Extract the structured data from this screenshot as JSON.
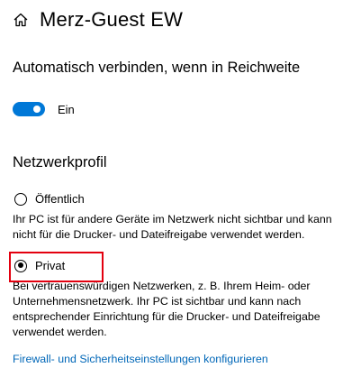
{
  "header": {
    "title": "Merz-Guest EW",
    "icon": "home-icon"
  },
  "auto_connect": {
    "heading": "Automatisch verbinden, wenn in Reichweite",
    "toggle_state": "on",
    "toggle_label": "Ein"
  },
  "network_profile": {
    "heading": "Netzwerkprofil",
    "selected": "private",
    "options": [
      {
        "label": "Öffentlich",
        "description": "Ihr PC ist für andere Geräte im Netzwerk nicht sichtbar und kann nicht für die Drucker- und Dateifreigabe verwendet werden."
      },
      {
        "label": "Privat",
        "description": "Bei vertrauenswürdigen Netzwerken, z. B. Ihrem Heim- oder Unternehmensnetzwerk. Ihr PC ist sichtbar und kann nach entsprechender Einrichtung für die Drucker- und Dateifreigabe verwendet werden."
      }
    ]
  },
  "firewall_link": {
    "label": "Firewall- und Sicherheitseinstellungen konfigurieren"
  },
  "colors": {
    "accent": "#0067c0",
    "toggle_on": "#0078d7",
    "highlight": "#e3000f",
    "text": "#000000",
    "link": "#0067b8"
  }
}
